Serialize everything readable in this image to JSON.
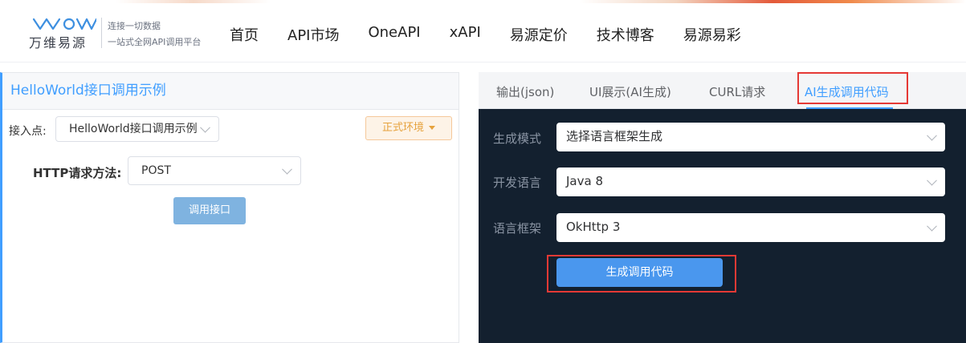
{
  "header": {
    "logo_text": "万维易源",
    "slogan_line1": "连接一切数据",
    "slogan_line2": "一站式全网API调用平台",
    "nav": [
      "首页",
      "API市场",
      "OneAPI",
      "xAPI",
      "易源定价",
      "技术博客",
      "易源易彩"
    ]
  },
  "left": {
    "title": "HelloWorld接口调用示例",
    "entry_label": "接入点:",
    "entry_value": "HelloWorld接口调用示例",
    "env_label": "正式环境",
    "method_label": "HTTP请求方法:",
    "method_value": "POST",
    "invoke_label": "调用接口"
  },
  "right": {
    "tabs": [
      "输出(json)",
      "UI展示(AI生成)",
      "CURL请求",
      "AI生成调用代码"
    ],
    "active_tab": "AI生成调用代码",
    "mode_label": "生成模式",
    "mode_value": "选择语言框架生成",
    "lang_label": "开发语言",
    "lang_value": "Java 8",
    "framework_label": "语言框架",
    "framework_value": "OkHttp 3",
    "generate_label": "生成调用代码"
  },
  "colors": {
    "accent": "#409eff",
    "dark_panel": "#13202f",
    "highlight": "#e53935",
    "env": "#e6a23c"
  }
}
